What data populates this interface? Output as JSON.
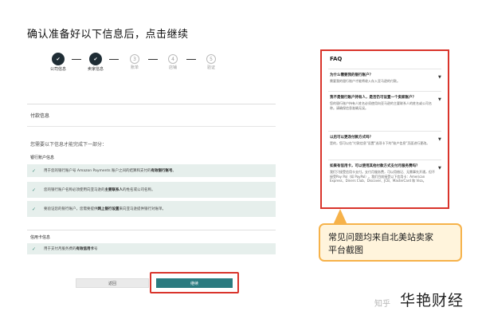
{
  "page": {
    "title": "确认准备好以下信息后，点击继续"
  },
  "stepper": {
    "steps": [
      {
        "number": "1",
        "label": "公司信息",
        "status": "done"
      },
      {
        "number": "2",
        "label": "卖家信息",
        "status": "done"
      },
      {
        "number": "3",
        "label": "账单",
        "status": "todo"
      },
      {
        "number": "4",
        "label": "店铺",
        "status": "todo"
      },
      {
        "number": "5",
        "label": "验证",
        "status": "todo"
      }
    ]
  },
  "form": {
    "section_title": "付款信息",
    "need_info_text": "您需要以下信息才能完成下一部分：",
    "bank_heading": "银行账户信息",
    "bank_items": [
      {
        "pre": "用于您的银行账户号 Amazon Payments 账户之间的结算和支付的",
        "bold": "有效银行账号",
        "post": "。"
      },
      {
        "pre": "您的银行账户名称必须使用向亚马逊的",
        "bold": "主要联系人",
        "post": "的姓名或公司名称。"
      },
      {
        "pre": "要验证您的银行账户，您需要提供",
        "bold": "网上银行设置",
        "post": "来向亚马逊提供银行对账单。"
      }
    ],
    "card_heading": "信用卡信息",
    "card_items": [
      {
        "pre": "用于支付月服务费的",
        "bold": "有效信用卡",
        "post": "号"
      }
    ]
  },
  "buttons": {
    "back_label": "返回",
    "continue_label": "继续"
  },
  "faq": {
    "title": "FAQ",
    "items": [
      {
        "q": "为什么需要我的银行账户？",
        "a": "需要我的银行账户才能将收入存入亚马逊的付款。"
      },
      {
        "q": "我不是银行账户持有人，是否仍可设置一个卖家账户？",
        "a": "您的银行账户持有人姓名必须使用向亚马逊的主要联系人的姓名或公司名称。请确保信息准确无误。"
      },
      {
        "q": "以后可以更改付款方式吗？",
        "a": "是的，您可以在\"付款信息\"设置\"选项卡下的\"账户信息\"页面进行更改。"
      },
      {
        "q": "如果有信用卡，可以使用其他付款方式支付月服务费吗？",
        "a": "我们只接受信用卡支付。支付月服务费，可以用借记、无需事先开通，但不接受Pay Pal（如 PayPal）。我们目前接受以下信用卡：American Express、Diners Club、Discover、JCB、MasterCard 和 Visa。"
      }
    ]
  },
  "callout": {
    "line1": "常见问题均来自北美站卖家",
    "line2": "平台截图"
  },
  "watermark": {
    "platform": "知乎",
    "brand": "华艳财经"
  },
  "colors": {
    "highlight_red": "#d9342b",
    "primary_teal": "#2b7b80",
    "step_done": "#1f2d35",
    "callout_border": "#f6b24a",
    "callout_bg": "#fff4dc",
    "check_row_bg": "#e6efec"
  }
}
